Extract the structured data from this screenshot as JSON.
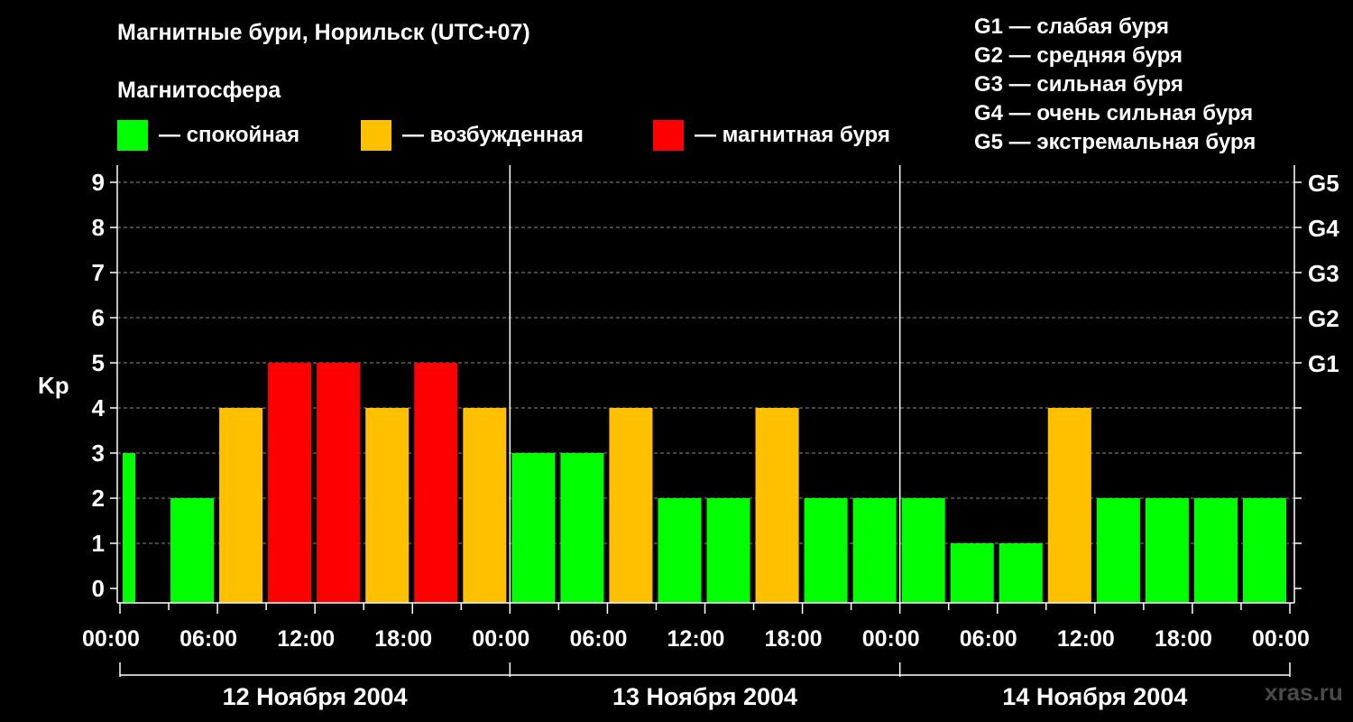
{
  "title": "Магнитные бури, Норильск (UTC+07)",
  "subtitle": "Магнитосфера",
  "legend": [
    {
      "label": "— спокойная",
      "color": "#00ff00"
    },
    {
      "label": "— возбужденная",
      "color": "#ffc000"
    },
    {
      "label": "— магнитная буря",
      "color": "#ff0000"
    }
  ],
  "g_scale": [
    "G1 — слабая буря",
    "G2 — средняя буря",
    "G3 — сильная буря",
    "G4 — очень сильная буря",
    "G5 — экстремальная буря"
  ],
  "watermark": "xras.ru",
  "chart_data": {
    "type": "bar",
    "ylabel": "Kp",
    "ylim": [
      0,
      9
    ],
    "yticks": [
      "0",
      "1",
      "2",
      "3",
      "4",
      "5",
      "6",
      "7",
      "8",
      "9"
    ],
    "g_levels": [
      {
        "level": 5,
        "label": "G1"
      },
      {
        "level": 6,
        "label": "G2"
      },
      {
        "level": 7,
        "label": "G3"
      },
      {
        "level": 8,
        "label": "G4"
      },
      {
        "level": 9,
        "label": "G5"
      }
    ],
    "xticks": [
      "00:00",
      "06:00",
      "12:00",
      "18:00",
      "00:00",
      "06:00",
      "12:00",
      "18:00",
      "00:00",
      "06:00",
      "12:00",
      "18:00",
      "00:00"
    ],
    "days": [
      "12 Ноября 2004",
      "13 Ноября 2004",
      "14 Ноября 2004"
    ],
    "x": [
      "00:00",
      "03:00",
      "06:00",
      "09:00",
      "12:00",
      "15:00",
      "18:00",
      "21:00",
      "00:00",
      "03:00",
      "06:00",
      "09:00",
      "12:00",
      "15:00",
      "18:00",
      "21:00",
      "00:00",
      "03:00",
      "06:00",
      "09:00",
      "12:00",
      "15:00",
      "18:00",
      "21:00"
    ],
    "values": [
      3,
      2,
      4,
      5,
      5,
      4,
      5,
      4,
      3,
      3,
      4,
      2,
      2,
      4,
      2,
      2,
      2,
      1,
      1,
      4,
      2,
      2,
      2,
      2
    ],
    "colors": {
      "quiet": "#00ff00",
      "active": "#ffc000",
      "storm": "#ff0000"
    },
    "grid": true
  }
}
